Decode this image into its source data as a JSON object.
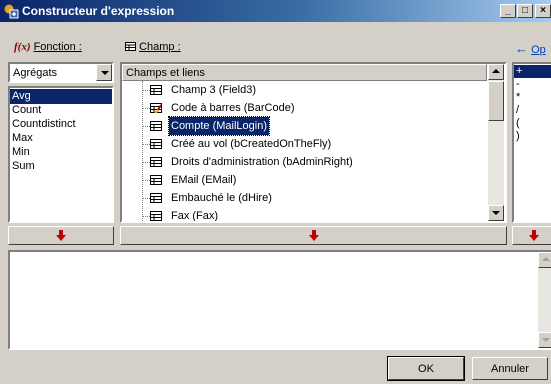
{
  "window": {
    "title": "Constructeur d'expression",
    "controls": [
      "_",
      "□",
      "×"
    ]
  },
  "function_section": {
    "label": "Fonction :",
    "accel": "F",
    "icon": "fx-icon",
    "combo_value": "Agrégats"
  },
  "function_list": {
    "items": [
      "Avg",
      "Count",
      "Countdistinct",
      "Max",
      "Min",
      "Sum"
    ],
    "selected": 0
  },
  "field_section": {
    "label": "Champ :",
    "accel": "C",
    "icon": "grid-icon"
  },
  "tree": {
    "header": "Champs et liens",
    "items": [
      {
        "label": "Champ 3 (Field3)",
        "icon": "field-icon"
      },
      {
        "label": "Code à barres (BarCode)",
        "icon": "barcode-field-icon"
      },
      {
        "label": "Compte (MailLogin)",
        "icon": "field-icon",
        "selected": true
      },
      {
        "label": "Créé au vol (bCreatedOnTheFly)",
        "icon": "field-icon"
      },
      {
        "label": "Droits d'administration (bAdminRight)",
        "icon": "field-icon"
      },
      {
        "label": "EMail (EMail)",
        "icon": "field-icon"
      },
      {
        "label": "Embauché le (dHire)",
        "icon": "field-icon"
      },
      {
        "label": "Fax (Fax)",
        "icon": "field-icon"
      }
    ]
  },
  "operator_section": {
    "label": "Op",
    "accel": "O",
    "icon": "operator-icon"
  },
  "operator_list": {
    "items": [
      "+",
      "-",
      "*",
      "/",
      "(",
      ")"
    ],
    "selected": 0
  },
  "expression_editor": {
    "value": ""
  },
  "buttons": {
    "ok": "OK",
    "cancel": "Annuler"
  },
  "colors": {
    "selection": "#0a246a",
    "titlebar_start": "#0a246a",
    "titlebar_end": "#a6caf0",
    "insert_arrow": "#c00000"
  }
}
